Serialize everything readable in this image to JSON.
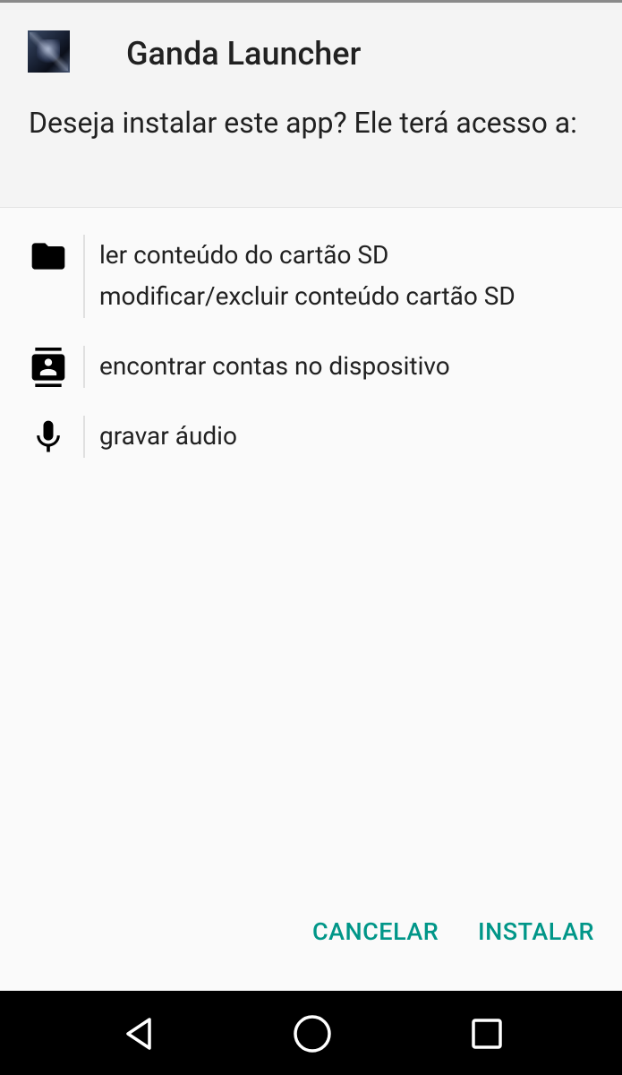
{
  "dialog": {
    "app_name": "Ganda Launcher",
    "prompt": "Deseja instalar este app? Ele terá acesso a:"
  },
  "permissions": [
    {
      "icon": "folder-icon",
      "lines": [
        "ler conteúdo do cartão SD",
        "modificar/excluir conteúdo cartão SD"
      ]
    },
    {
      "icon": "contacts-icon",
      "lines": [
        "encontrar contas no dispositivo"
      ]
    },
    {
      "icon": "microphone-icon",
      "lines": [
        "gravar áudio"
      ]
    }
  ],
  "buttons": {
    "cancel": "CANCELAR",
    "install": "INSTALAR"
  },
  "colors": {
    "accent": "#009688",
    "header_bg": "#f4f4f4",
    "body_bg": "#fafafa",
    "navbar_bg": "#000000"
  },
  "navbar": {
    "items": [
      "back-icon",
      "home-icon",
      "recents-icon"
    ]
  }
}
